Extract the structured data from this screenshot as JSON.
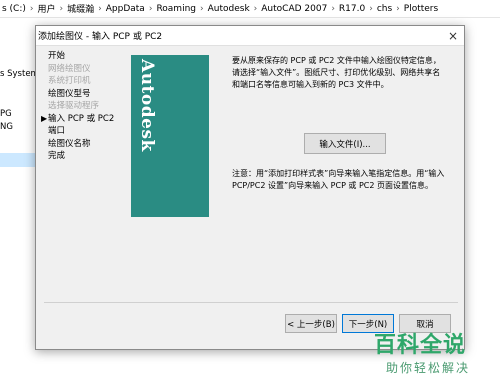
{
  "explorer": {
    "breadcrumbs": [
      "s (C:)",
      "用户",
      "城缀瀚",
      "AppData",
      "Roaming",
      "Autodesk",
      "AutoCAD 2007",
      "R17.0",
      "chs",
      "Plotters"
    ],
    "left_items": [
      "s System",
      "PG",
      "NG"
    ]
  },
  "dialog": {
    "title": "添加绘图仪 - 输入 PCP 或 PC2",
    "close_glyph": "×",
    "steps": [
      {
        "label": "开始",
        "disabled": false,
        "current": false
      },
      {
        "label": "网络绘图仪",
        "disabled": true,
        "current": false
      },
      {
        "label": "系统打印机",
        "disabled": true,
        "current": false
      },
      {
        "label": "绘图仪型号",
        "disabled": false,
        "current": false
      },
      {
        "label": "选择驱动程序",
        "disabled": true,
        "current": false
      },
      {
        "label": "输入 PCP 或 PC2",
        "disabled": false,
        "current": true
      },
      {
        "label": "端口",
        "disabled": false,
        "current": false
      },
      {
        "label": "绘图仪名称",
        "disabled": false,
        "current": false
      },
      {
        "label": "完成",
        "disabled": false,
        "current": false
      }
    ],
    "banner_text": "Autodesk",
    "description": "要从原来保存的 PCP 或 PC2 文件中输入绘图仪特定信息，请选择“输入文件”。图纸尺寸、打印优化级别、网络共享名和端口名等信息可输入到新的 PC3 文件中。",
    "import_button": "输入文件(I)...",
    "note": "注意：用“添加打印样式表”向导来输入笔指定信息。用“输入 PCP/PC2 设置”向导来输入 PCP 或 PC2 页面设置信息。",
    "back_button": "< 上一步(B)",
    "next_button": "下一步(N)",
    "cancel_button": "取消"
  },
  "watermark": {
    "main": "百科全说",
    "sub": "助你轻松解决"
  }
}
